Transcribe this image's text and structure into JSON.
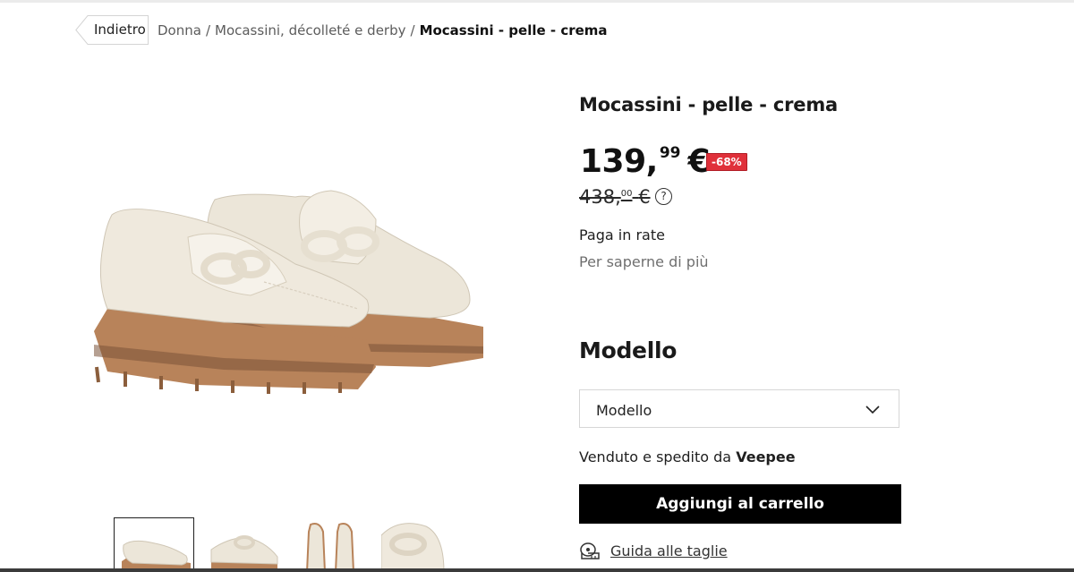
{
  "breadcrumb": {
    "back_label": "Indietro",
    "items": [
      "Donna",
      "Mocassini, décolleté e derby"
    ],
    "separator": "/",
    "current": "Mocassini - pelle - crema"
  },
  "product": {
    "title": "Mocassini - pelle - crema",
    "price_int": "139,",
    "price_dec": "99",
    "currency": "€",
    "discount": "-68%",
    "old_price_int": "438,",
    "old_price_dec": "00",
    "old_currency": "€",
    "help_icon": "?",
    "installments_label": "Paga in rate",
    "installments_link": "Per saperne di più",
    "model_heading": "Modello",
    "model_select_value": "Modello",
    "seller_prefix": "Venduto e spedito da",
    "seller_name": "Veepee",
    "add_to_cart": "Aggiungi al carrello",
    "size_guide": "Guida alle taglie"
  },
  "gallery": {
    "selected_index": 0,
    "thumb_count": 4
  },
  "colors": {
    "discount_bg": "#e0303a",
    "cta_bg": "#000000",
    "leather": "#ece6d9",
    "sole": "#b8835a"
  },
  "icons": [
    "back-arrow-icon",
    "help-icon",
    "chevron-down-icon",
    "measuring-tape-icon"
  ]
}
